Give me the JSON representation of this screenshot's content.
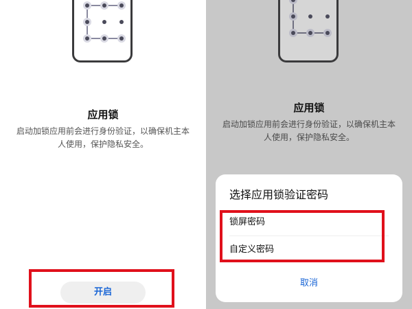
{
  "left": {
    "title": "应用锁",
    "description": "启动加锁应用前会进行身份验证，以确保机主本人使用，保护隐私安全。",
    "enable_button": "开启"
  },
  "right": {
    "title": "应用锁",
    "description": "启动加锁应用前会进行身份验证，以确保机主本人使用，保护隐私安全。",
    "dialog": {
      "title": "选择应用锁验证密码",
      "options": [
        "锁屏密码",
        "自定义密码"
      ],
      "cancel": "取消"
    }
  },
  "colors": {
    "accent": "#1a66d6",
    "highlight": "#e0101b",
    "overlay": "#c8c8c8"
  }
}
